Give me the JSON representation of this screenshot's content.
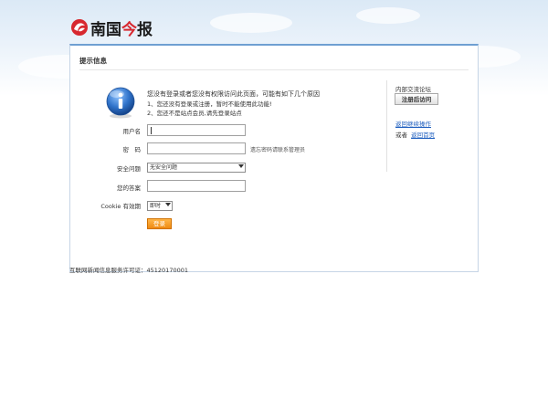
{
  "brand": {
    "logo_prefix": "南国",
    "logo_middle": "今",
    "logo_suffix": "报",
    "accent_red": "#d7282f"
  },
  "panel": {
    "title": "提示信息",
    "message": {
      "line1": "您没有登录或者您没有权限访问此页面，可能有如下几个原因",
      "line2": "1、您还没有登录或注册，暂时不能使用此功能!",
      "line3": "2、您还不是站点会员,请先登录站点"
    },
    "icon": "info-icon"
  },
  "form": {
    "username_label": "用户名",
    "password_label": "密　码",
    "forgot_hint": "遗忘密码请联系管理员",
    "security_label": "安全问题",
    "security_value": "无安全问题",
    "answer_label": "您的答案",
    "cookie_label": "Cookie 有效期",
    "cookie_value": "即时",
    "login_label": "登录"
  },
  "sidebar": {
    "label": "内部交流论坛",
    "register_label": "注册后访问",
    "back_label": "返回继续操作",
    "or_text": "或者",
    "home_label": "返回首页"
  },
  "footer": {
    "license": "互联网新闻信息服务许可证：45120170001"
  }
}
